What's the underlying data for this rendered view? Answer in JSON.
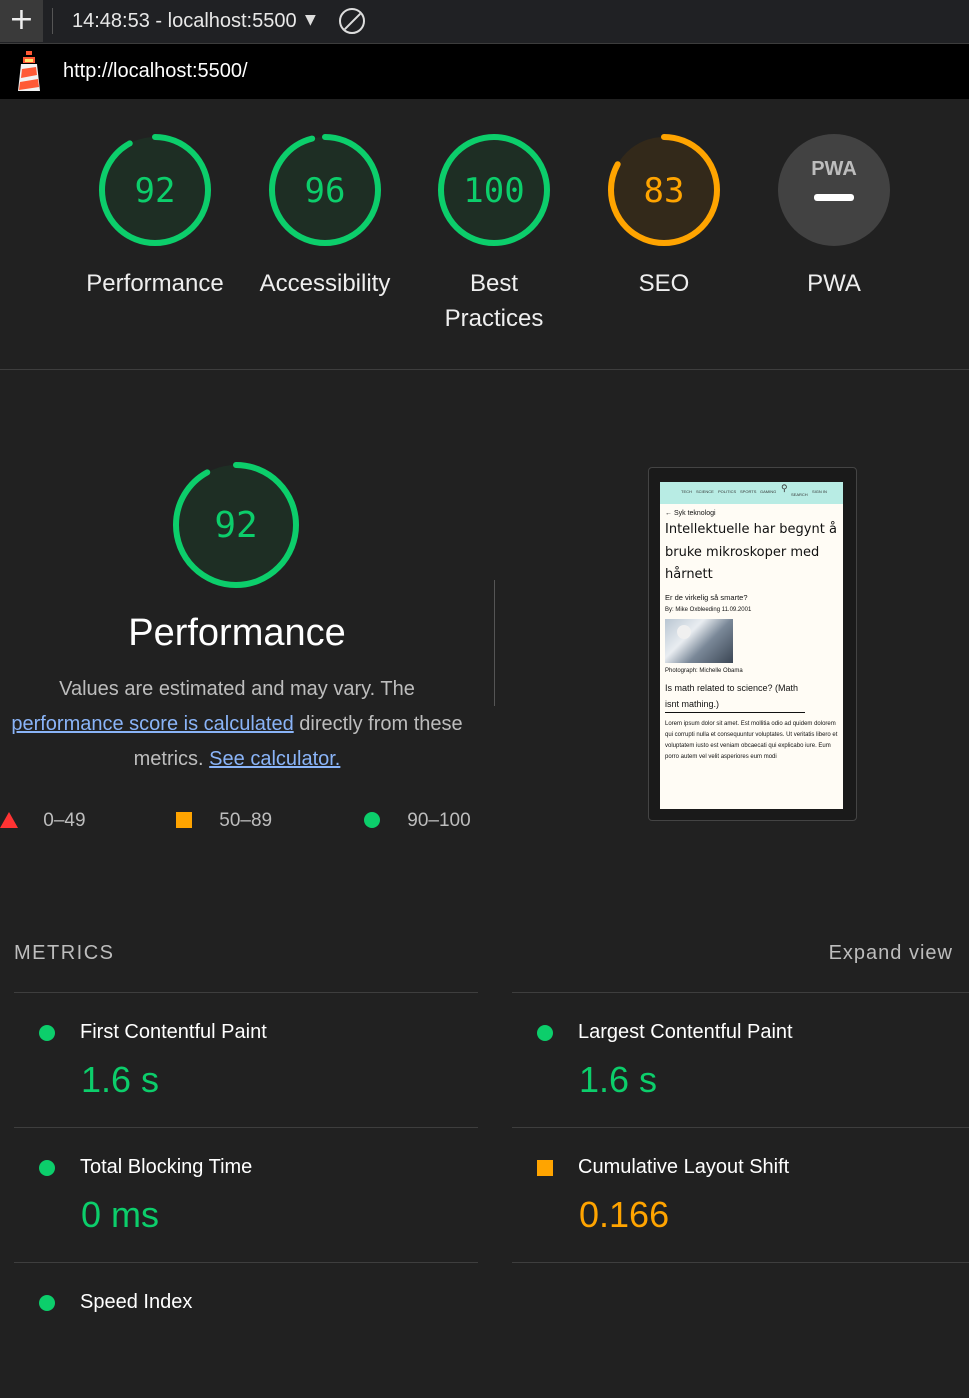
{
  "toolbar": {
    "new_tab_icon": "plus-icon",
    "session_label": "14:48:53 - localhost:5500",
    "dropdown_icon": "caret-down-icon",
    "clear_icon": "blocked-circle-icon"
  },
  "url_bar": {
    "logo_icon": "lighthouse-icon",
    "url": "http://localhost:5500/"
  },
  "categories": [
    {
      "score": "92",
      "label": "Performance",
      "color": "#0cce6b",
      "fraction": 0.92
    },
    {
      "score": "96",
      "label": "Accessibility",
      "color": "#0cce6b",
      "fraction": 0.96
    },
    {
      "score": "100",
      "label": "Best Practices",
      "color": "#0cce6b",
      "fraction": 1.0
    },
    {
      "score": "83",
      "label": "SEO",
      "color": "#ffa400",
      "fraction": 0.83
    },
    {
      "score": "PWA",
      "label": "PWA",
      "color": "#5a5a5a",
      "fraction": 0
    }
  ],
  "performance": {
    "score": "92",
    "fraction": 0.92,
    "title": "Performance",
    "desc_part1": "Values are estimated and may vary. The",
    "desc_link1": "performance score is calculated",
    "desc_part2": "directly from these metrics.",
    "desc_link2": "See calculator.",
    "legend": [
      {
        "shape": "triangle",
        "range": "0–49",
        "color": "#ff3333"
      },
      {
        "shape": "square",
        "range": "50–89",
        "color": "#ffa400"
      },
      {
        "shape": "circle",
        "range": "90–100",
        "color": "#0cce6b"
      }
    ]
  },
  "screenshot": {
    "nav_items": [
      "TECH",
      "SCIENCE",
      "POLITICS",
      "SPORTS",
      "GAMING",
      "SEARCH",
      "SIGN IN"
    ],
    "breadcrumb": "Syk teknologi",
    "headline": "Intellektuelle har begynt å bruke mikroskoper med hårnett",
    "subtitle": "Er de virkelig så smarte?",
    "byline": "By: Mike Oxbleeding 11.09.2001",
    "photo_credit": "Photograph: Michelle Obama",
    "link_text": "Is math related to science? (Math isnt mathing.)",
    "lorem": "Lorem ipsum dolor sit amet. Est mollitia odio ad quidem dolorem qui corrupti nulla et consequuntur voluptates. Ut veritatis libero et voluptatem iusto est veniam obcaecati qui explicabo iure. Eum porro autem vel velit asperiores eum modi"
  },
  "metrics": {
    "header": "METRICS",
    "expand_label": "Expand view",
    "items": [
      {
        "name": "First Contentful Paint",
        "value": "1.6 s",
        "rating": "pass",
        "color": "#0cce6b"
      },
      {
        "name": "Largest Contentful Paint",
        "value": "1.6 s",
        "rating": "pass",
        "color": "#0cce6b"
      },
      {
        "name": "Total Blocking Time",
        "value": "0 ms",
        "rating": "pass",
        "color": "#0cce6b"
      },
      {
        "name": "Cumulative Layout Shift",
        "value": "0.166",
        "rating": "average",
        "color": "#ffa400"
      },
      {
        "name": "Speed Index",
        "value": "",
        "rating": "pass",
        "color": "#0cce6b"
      }
    ]
  }
}
